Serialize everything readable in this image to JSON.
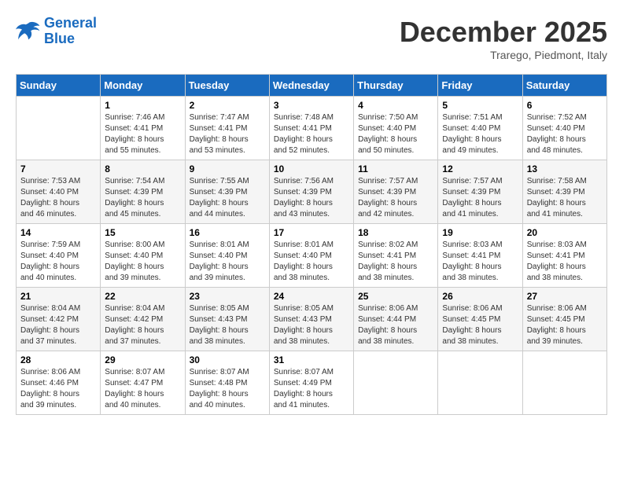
{
  "header": {
    "logo_line1": "General",
    "logo_line2": "Blue",
    "month": "December 2025",
    "location": "Trarego, Piedmont, Italy"
  },
  "days_of_week": [
    "Sunday",
    "Monday",
    "Tuesday",
    "Wednesday",
    "Thursday",
    "Friday",
    "Saturday"
  ],
  "weeks": [
    [
      {
        "day": "",
        "info": ""
      },
      {
        "day": "1",
        "info": "Sunrise: 7:46 AM\nSunset: 4:41 PM\nDaylight: 8 hours\nand 55 minutes."
      },
      {
        "day": "2",
        "info": "Sunrise: 7:47 AM\nSunset: 4:41 PM\nDaylight: 8 hours\nand 53 minutes."
      },
      {
        "day": "3",
        "info": "Sunrise: 7:48 AM\nSunset: 4:41 PM\nDaylight: 8 hours\nand 52 minutes."
      },
      {
        "day": "4",
        "info": "Sunrise: 7:50 AM\nSunset: 4:40 PM\nDaylight: 8 hours\nand 50 minutes."
      },
      {
        "day": "5",
        "info": "Sunrise: 7:51 AM\nSunset: 4:40 PM\nDaylight: 8 hours\nand 49 minutes."
      },
      {
        "day": "6",
        "info": "Sunrise: 7:52 AM\nSunset: 4:40 PM\nDaylight: 8 hours\nand 48 minutes."
      }
    ],
    [
      {
        "day": "7",
        "info": "Sunrise: 7:53 AM\nSunset: 4:40 PM\nDaylight: 8 hours\nand 46 minutes."
      },
      {
        "day": "8",
        "info": "Sunrise: 7:54 AM\nSunset: 4:39 PM\nDaylight: 8 hours\nand 45 minutes."
      },
      {
        "day": "9",
        "info": "Sunrise: 7:55 AM\nSunset: 4:39 PM\nDaylight: 8 hours\nand 44 minutes."
      },
      {
        "day": "10",
        "info": "Sunrise: 7:56 AM\nSunset: 4:39 PM\nDaylight: 8 hours\nand 43 minutes."
      },
      {
        "day": "11",
        "info": "Sunrise: 7:57 AM\nSunset: 4:39 PM\nDaylight: 8 hours\nand 42 minutes."
      },
      {
        "day": "12",
        "info": "Sunrise: 7:57 AM\nSunset: 4:39 PM\nDaylight: 8 hours\nand 41 minutes."
      },
      {
        "day": "13",
        "info": "Sunrise: 7:58 AM\nSunset: 4:39 PM\nDaylight: 8 hours\nand 41 minutes."
      }
    ],
    [
      {
        "day": "14",
        "info": "Sunrise: 7:59 AM\nSunset: 4:40 PM\nDaylight: 8 hours\nand 40 minutes."
      },
      {
        "day": "15",
        "info": "Sunrise: 8:00 AM\nSunset: 4:40 PM\nDaylight: 8 hours\nand 39 minutes."
      },
      {
        "day": "16",
        "info": "Sunrise: 8:01 AM\nSunset: 4:40 PM\nDaylight: 8 hours\nand 39 minutes."
      },
      {
        "day": "17",
        "info": "Sunrise: 8:01 AM\nSunset: 4:40 PM\nDaylight: 8 hours\nand 38 minutes."
      },
      {
        "day": "18",
        "info": "Sunrise: 8:02 AM\nSunset: 4:41 PM\nDaylight: 8 hours\nand 38 minutes."
      },
      {
        "day": "19",
        "info": "Sunrise: 8:03 AM\nSunset: 4:41 PM\nDaylight: 8 hours\nand 38 minutes."
      },
      {
        "day": "20",
        "info": "Sunrise: 8:03 AM\nSunset: 4:41 PM\nDaylight: 8 hours\nand 38 minutes."
      }
    ],
    [
      {
        "day": "21",
        "info": "Sunrise: 8:04 AM\nSunset: 4:42 PM\nDaylight: 8 hours\nand 37 minutes."
      },
      {
        "day": "22",
        "info": "Sunrise: 8:04 AM\nSunset: 4:42 PM\nDaylight: 8 hours\nand 37 minutes."
      },
      {
        "day": "23",
        "info": "Sunrise: 8:05 AM\nSunset: 4:43 PM\nDaylight: 8 hours\nand 38 minutes."
      },
      {
        "day": "24",
        "info": "Sunrise: 8:05 AM\nSunset: 4:43 PM\nDaylight: 8 hours\nand 38 minutes."
      },
      {
        "day": "25",
        "info": "Sunrise: 8:06 AM\nSunset: 4:44 PM\nDaylight: 8 hours\nand 38 minutes."
      },
      {
        "day": "26",
        "info": "Sunrise: 8:06 AM\nSunset: 4:45 PM\nDaylight: 8 hours\nand 38 minutes."
      },
      {
        "day": "27",
        "info": "Sunrise: 8:06 AM\nSunset: 4:45 PM\nDaylight: 8 hours\nand 39 minutes."
      }
    ],
    [
      {
        "day": "28",
        "info": "Sunrise: 8:06 AM\nSunset: 4:46 PM\nDaylight: 8 hours\nand 39 minutes."
      },
      {
        "day": "29",
        "info": "Sunrise: 8:07 AM\nSunset: 4:47 PM\nDaylight: 8 hours\nand 40 minutes."
      },
      {
        "day": "30",
        "info": "Sunrise: 8:07 AM\nSunset: 4:48 PM\nDaylight: 8 hours\nand 40 minutes."
      },
      {
        "day": "31",
        "info": "Sunrise: 8:07 AM\nSunset: 4:49 PM\nDaylight: 8 hours\nand 41 minutes."
      },
      {
        "day": "",
        "info": ""
      },
      {
        "day": "",
        "info": ""
      },
      {
        "day": "",
        "info": ""
      }
    ]
  ]
}
